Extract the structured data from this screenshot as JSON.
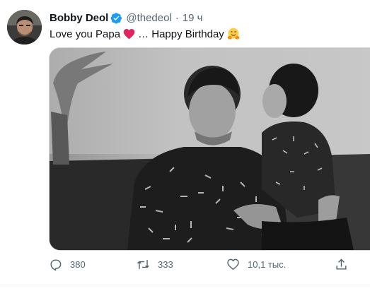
{
  "tweet": {
    "author": {
      "name": "Bobby Deol",
      "handle": "@thedeol",
      "separator": "·",
      "time": "19 ч"
    },
    "text": {
      "part1": "Love you Papa",
      "part2": "… Happy Birthday"
    },
    "icons": {
      "verified": "verified-badge-icon",
      "heart_emoji": "red-heart-emoji",
      "hug_emoji": "hugging-face-emoji"
    },
    "actions": {
      "reply_count": "380",
      "retweet_count": "333",
      "like_count": "10,1 тыс.",
      "share": "share-icon"
    },
    "colors": {
      "verified": "#1d9bf0",
      "secondary_text": "#536471",
      "heart": "#e0245e"
    }
  }
}
